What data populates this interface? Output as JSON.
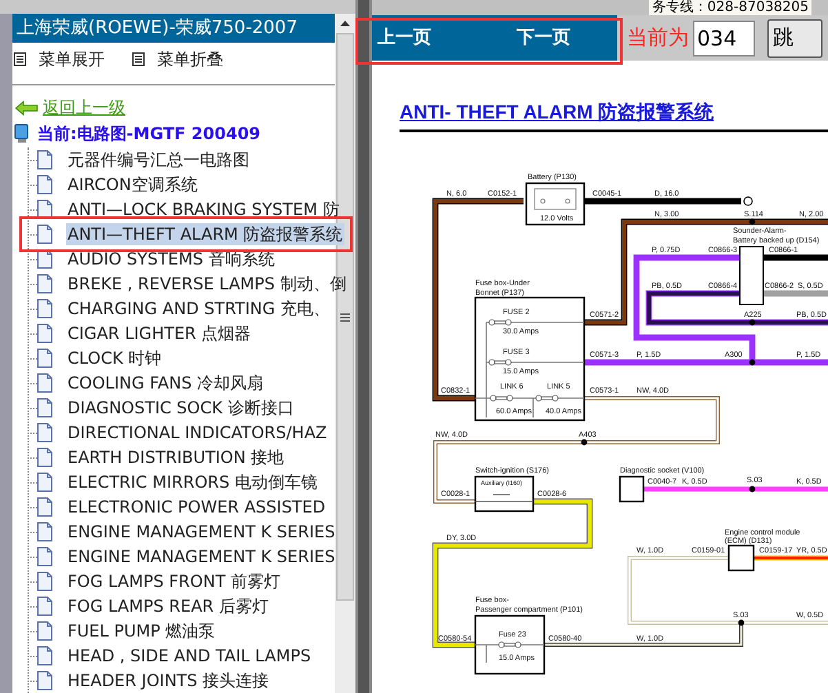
{
  "sidebar": {
    "title": "上海荣威(ROEWE)-荣威750-2007",
    "actions": [
      {
        "label": "菜单展开"
      },
      {
        "label": "菜单折叠"
      }
    ],
    "back_link": "返回上一级",
    "current": "当前:电路图-MGTF 200409",
    "items": [
      {
        "label": "元器件编号汇总一电路图",
        "selected": false
      },
      {
        "label": "AIRCON空调系统",
        "selected": false
      },
      {
        "label": "ANTI—LOCK BRAKING SYSTEM 防",
        "selected": false
      },
      {
        "label": "ANTI—THEFT ALARM 防盗报警系统",
        "selected": true
      },
      {
        "label": "AUDIO SYSTEMS 音响系统",
        "selected": false
      },
      {
        "label": "BREKE , REVERSE LAMPS 制动、倒",
        "selected": false
      },
      {
        "label": "CHARGING AND STRTING 充电、",
        "selected": false
      },
      {
        "label": "CIGAR LIGHTER 点烟器",
        "selected": false
      },
      {
        "label": "CLOCK 时钟",
        "selected": false
      },
      {
        "label": "COOLING FANS 冷却风扇",
        "selected": false
      },
      {
        "label": "DIAGNOSTIC SOCK 诊断接口",
        "selected": false
      },
      {
        "label": "DIRECTIONAL INDICATORS/HAZ",
        "selected": false
      },
      {
        "label": "EARTH DISTRIBUTION 接地",
        "selected": false
      },
      {
        "label": "ELECTRIC MIRRORS 电动倒车镜",
        "selected": false
      },
      {
        "label": "ELECTRONIC POWER ASSISTED",
        "selected": false
      },
      {
        "label": "ENGINE MANAGEMENT K SERIES",
        "selected": false
      },
      {
        "label": "ENGINE MANAGEMENT K SERIES",
        "selected": false
      },
      {
        "label": "FOG LAMPS FRONT 前雾灯",
        "selected": false
      },
      {
        "label": "FOG LAMPS REAR 后雾灯",
        "selected": false
      },
      {
        "label": "FUEL PUMP 燃油泵",
        "selected": false
      },
      {
        "label": "HEAD , SIDE AND TAIL LAMPS",
        "selected": false
      },
      {
        "label": "HEADER JOINTS 接头连接",
        "selected": false
      }
    ]
  },
  "top_notice": "务专线：028-87038205",
  "toolbar": {
    "prev": "上一页",
    "next": "下一页",
    "current_label": "当前为",
    "page_field": {
      "value": "034"
    },
    "go_button": "跳"
  },
  "document": {
    "title": "ANTI- THEFT ALARM 防盗报警系统",
    "diagram_labels": [
      "Battery (P130)",
      "12.0 Volts",
      "N, 6.0",
      "C0152-1",
      "C0045-1",
      "D, 16.0",
      "N, 3.00",
      "S.114",
      "N, 2.00",
      "Sounder-Alarm-",
      "Battery backed up (D154)",
      "P, 0.75D",
      "C0866-3",
      "C0866-1",
      "PB, 0.5D",
      "C0866-4",
      "C0866-2",
      "S, 0.5D",
      "A225",
      "PB, 0.5D",
      "Fuse box-Under",
      "Bonnet (P137)",
      "FUSE 2",
      "30.0 Amps",
      "C0571-2",
      "FUSE 3",
      "15.0 Amps",
      "C0571-3",
      "P, 1.5D",
      "A300",
      "P, 1.5D",
      "LINK 6",
      "LINK 5",
      "60.0 Amps",
      "40.0 Amps",
      "C0832-1",
      "C0573-1",
      "NW, 4.0D",
      "NW, 4.0D",
      "A403",
      "Switch-ignition (S176)",
      "Auxiliary (I160)",
      "C0028-1",
      "C0028-6",
      "Diagnostic socket (V100)",
      "C0040-7",
      "K, 0.5D",
      "S.03",
      "K, 0.5D",
      "DY, 3.0D",
      "Engine control module",
      "(ECM) (D131)",
      "W, 1.0D",
      "C0159-01",
      "C0159-17",
      "YR, 0.5D",
      "S.03",
      "W, 0.5D",
      "Fuse box-",
      "Passenger compartment (P101)",
      "Fuse 23",
      "15.0 Amps",
      "C0580-54",
      "C0580-40",
      "W, 1.0D"
    ]
  }
}
